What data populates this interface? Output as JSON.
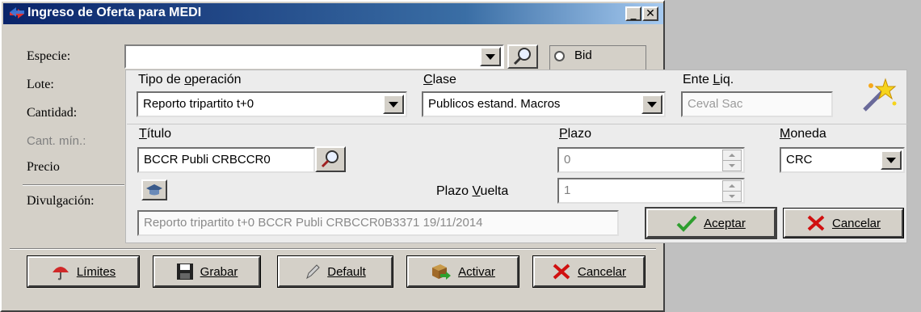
{
  "window": {
    "title": "Ingreso de Oferta para MEDI",
    "minimize_glyph": "_",
    "close_glyph": "✕"
  },
  "form": {
    "especie_label": "Especie:",
    "lote_label": "Lote:",
    "cantidad_label": "Cantidad:",
    "cant_min_label": "Cant. mín.:",
    "precio_label": "Precio",
    "divulgacion_label": "Divulgación:",
    "especie_value": "",
    "radio_bid_label": "Bid"
  },
  "overlay": {
    "tipo_label": "Tipo de operación",
    "tipo_value": "Reporto tripartito t+0",
    "clase_label": "Clase",
    "clase_value": "Publicos estand. Macros",
    "ente_label": "Ente Liq.",
    "ente_placeholder": "Ceval Sac",
    "titulo_label": "Título",
    "titulo_value": "BCCR Publi CRBCCR0",
    "plazo_label": "Plazo",
    "plazo_value": "0",
    "moneda_label": "Moneda",
    "moneda_value": "CRC",
    "plazo_vuelta_label": "Plazo Vuelta",
    "plazo_vuelta_value": "1",
    "descripcion": "Reporto tripartito t+0 BCCR Publi CRBCCR0B3371 19/11/2014",
    "aceptar_label": "Aceptar",
    "cancelar_label": "Cancelar"
  },
  "buttons": {
    "limites": "Límites",
    "grabar": "Grabar",
    "default": "Default",
    "activar": "Activar",
    "cancelar": "Cancelar"
  },
  "colors": {
    "titlebar": "#0a246a",
    "window_bg": "#d4d0c8",
    "panel_bg": "#ececec",
    "check_green": "#2e9e2e",
    "cancel_red": "#d01010"
  }
}
